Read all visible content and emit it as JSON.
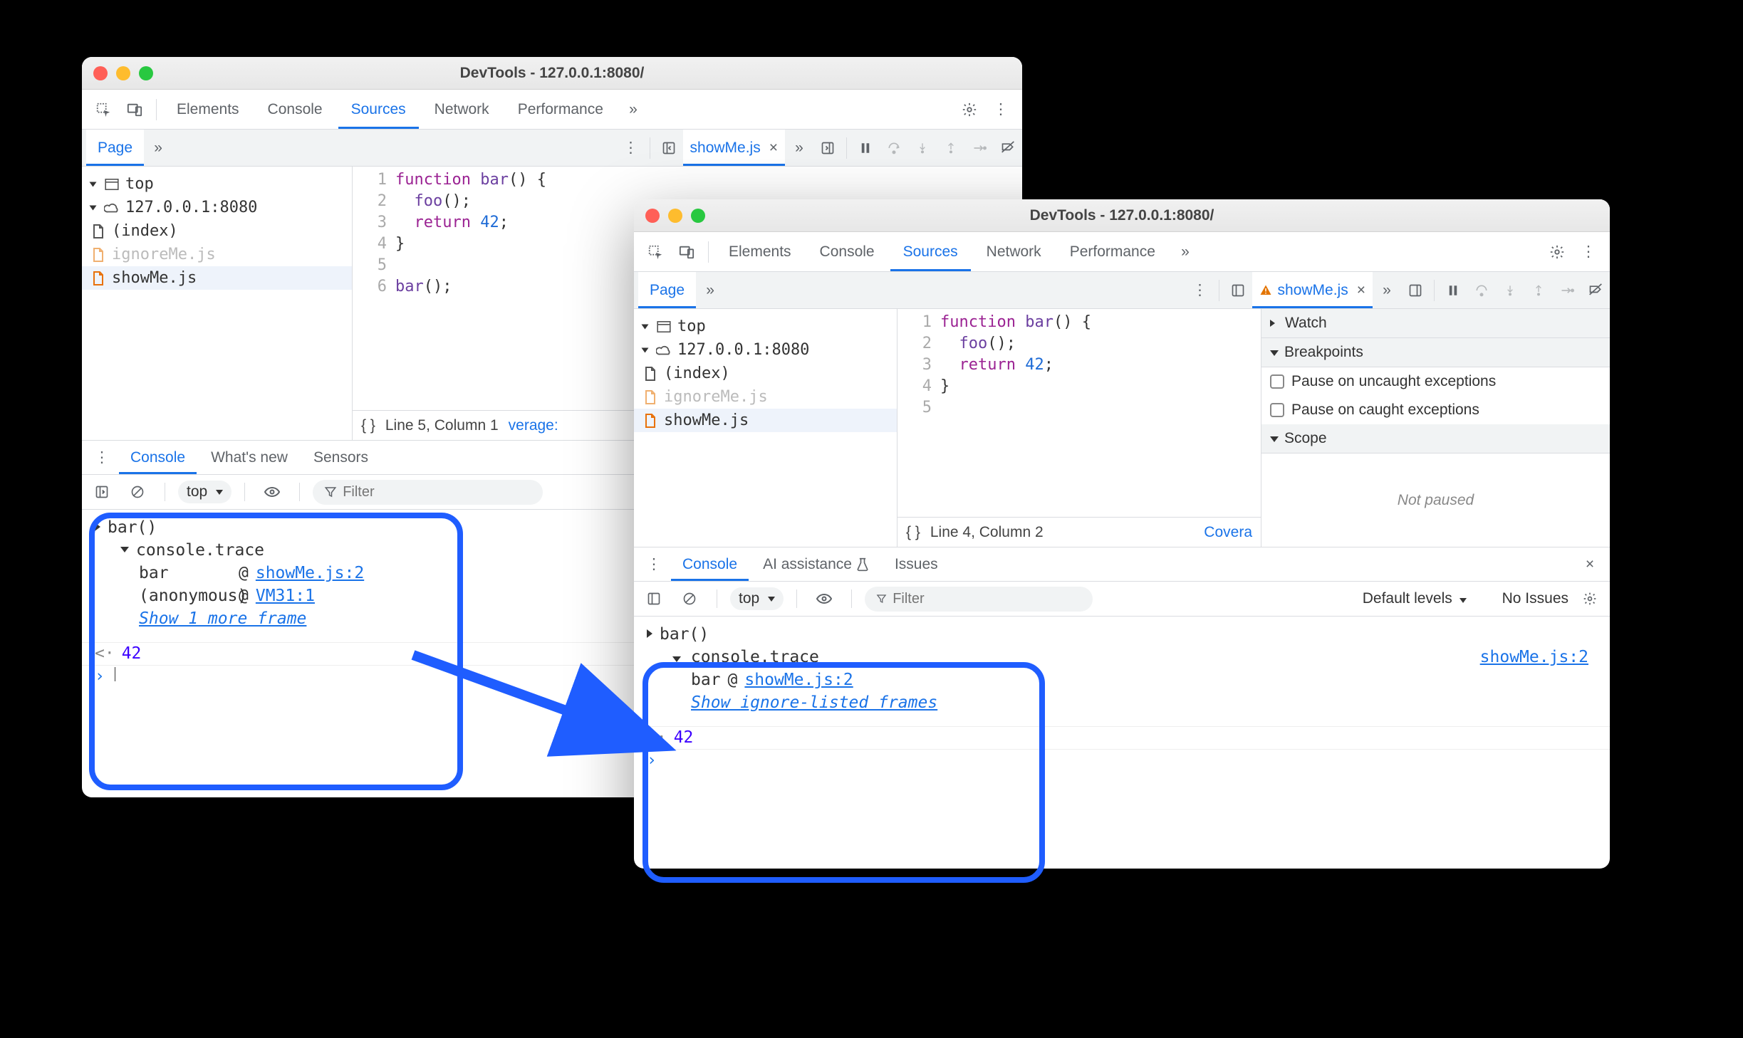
{
  "window_title": "DevTools - 127.0.0.1:8080/",
  "main_tabs": [
    "Elements",
    "Console",
    "Sources",
    "Network",
    "Performance"
  ],
  "page_tab": "Page",
  "open_file": "showMe.js",
  "tree": {
    "top": "top",
    "host": "127.0.0.1:8080",
    "files": [
      "(index)",
      "ignoreMe.js",
      "showMe.js"
    ]
  },
  "code1": {
    "lines": [
      1,
      2,
      3,
      4,
      5,
      6
    ],
    "text": [
      "function bar() {",
      "  foo();",
      "  return 42;",
      "}",
      "",
      "bar();"
    ]
  },
  "code2": {
    "lines": [
      1,
      2,
      3,
      4,
      5
    ],
    "text": [
      "function bar() {",
      "  foo();",
      "  return 42;",
      "}",
      ""
    ]
  },
  "status1": "Line 5, Column 1",
  "status1_cov": "verage:",
  "status2": "Line 4, Column 2",
  "status2_cov": "Covera",
  "drawer_tabs1": [
    "Console",
    "What's new",
    "Sensors"
  ],
  "drawer_tabs2": [
    "Console",
    "AI assistance",
    "Issues"
  ],
  "filter_placeholder": "Filter",
  "ctx": "top",
  "default_levels": "Default levels",
  "no_issues": "No Issues",
  "console1": {
    "call": "bar()",
    "trace": "console.trace",
    "frames": [
      {
        "fn": "bar",
        "at": "showMe.js:2"
      },
      {
        "fn": "(anonymous)",
        "at": "VM31:1"
      }
    ],
    "show_more": "Show 1 more frame",
    "return": "42"
  },
  "console2": {
    "call": "bar()",
    "trace": "console.trace",
    "trace_at": "showMe.js:2",
    "frames": [
      {
        "fn": "bar",
        "at": "showMe.js:2"
      }
    ],
    "show_more": "Show ignore-listed frames",
    "return": "42"
  },
  "sidepanel": {
    "watch": "Watch",
    "breakpoints": "Breakpoints",
    "pause_uncaught": "Pause on uncaught exceptions",
    "pause_caught": "Pause on caught exceptions",
    "scope": "Scope",
    "not_paused": "Not paused"
  },
  "at_sym": "@"
}
